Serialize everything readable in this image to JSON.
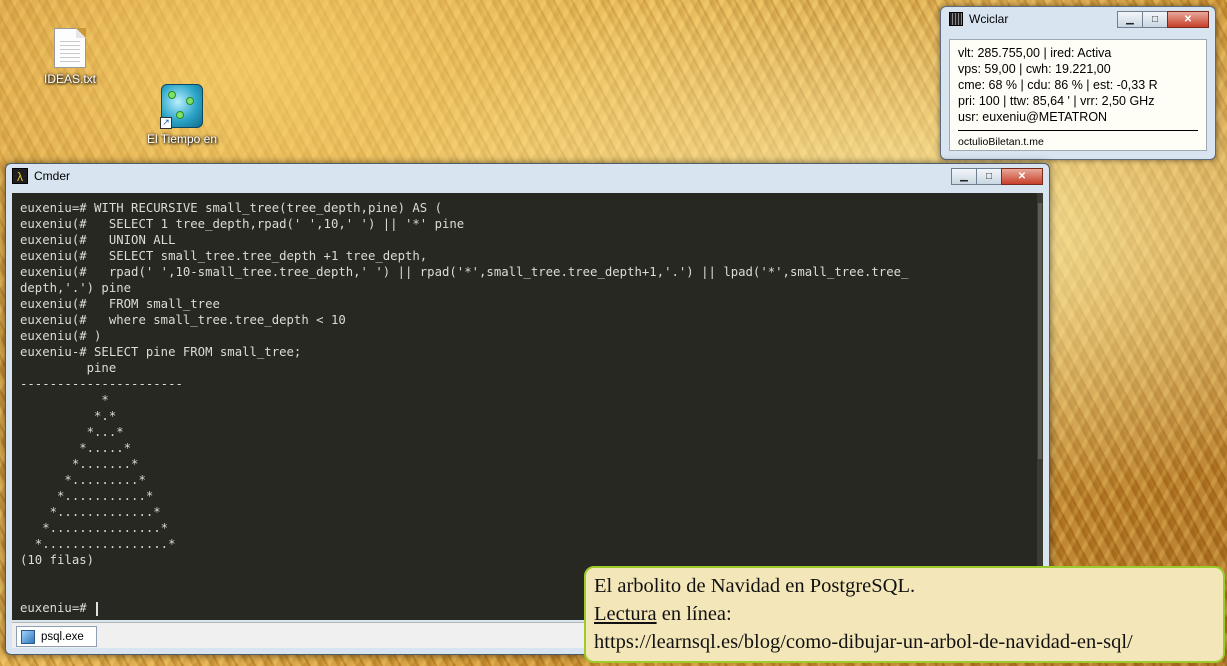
{
  "desktop": {
    "icons": [
      {
        "label": "IDEAS.txt",
        "icon": "text-file-icon"
      },
      {
        "label": "El Tiempo en",
        "icon": "weather-app-icon"
      }
    ]
  },
  "gadget": {
    "title": "Wciclar",
    "lines": [
      "vlt: 285.755,00 | ired: Activa",
      "vps: 59,00 | cwh: 19.221,00",
      "cme: 68 % | cdu: 86 % | est: -0,33 R",
      "pri: 100 | ttw: 85,64 ' | vrr: 2,50 GHz",
      "usr: euxeniu@METATRON"
    ],
    "footer": "octulioBiletan.t.me"
  },
  "cmder": {
    "title": "Cmder",
    "console_lines": [
      "euxeniu=# WITH RECURSIVE small_tree(tree_depth,pine) AS (",
      "euxeniu(#   SELECT 1 tree_depth,rpad(' ',10,' ') || '*' pine",
      "euxeniu(#   UNION ALL",
      "euxeniu(#   SELECT small_tree.tree_depth +1 tree_depth,",
      "euxeniu(#   rpad(' ',10-small_tree.tree_depth,' ') || rpad('*',small_tree.tree_depth+1,'.') || lpad('*',small_tree.tree_",
      "depth,'.') pine",
      "euxeniu(#   FROM small_tree",
      "euxeniu(#   where small_tree.tree_depth < 10",
      "euxeniu(# )",
      "euxeniu-# SELECT pine FROM small_tree;",
      "         pine",
      "----------------------",
      "           *",
      "          *.*",
      "         *...*",
      "        *.....*",
      "       *.......*",
      "      *.........*",
      "     *...........*",
      "    *.............*",
      "   *...............*",
      "  *.................*",
      "(10 filas)",
      "",
      "",
      "euxeniu=# "
    ],
    "tab_label": "psql.exe"
  },
  "note": {
    "line1": "El arbolito de Navidad en PostgreSQL.",
    "line2_link": "Lectura",
    "line2_rest": " en línea:",
    "url": "https://learnsql.es/blog/como-dibujar-un-arbol-de-navidad-en-sql/"
  },
  "colors": {
    "console_bg": "#272822",
    "console_fg": "#dcdcd2",
    "note_bg": "#f3e6b8",
    "note_border": "#9ccc2c"
  }
}
